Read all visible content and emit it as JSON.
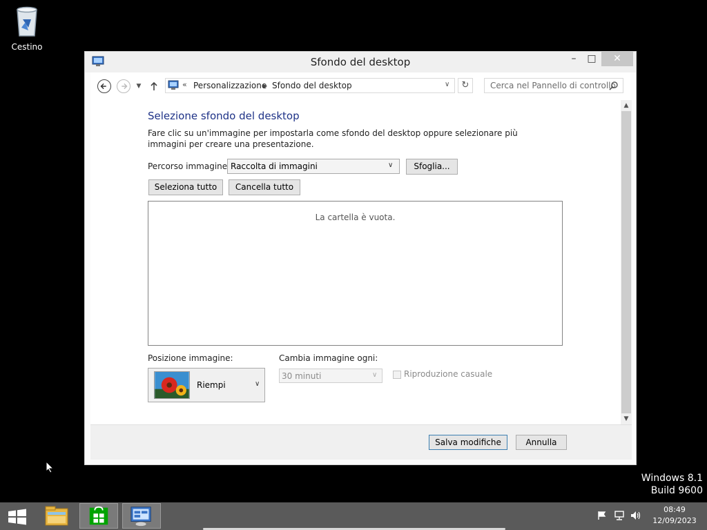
{
  "desktop": {
    "recycle_bin_label": "Cestino",
    "watermark_line1": "Windows 8.1",
    "watermark_line2": "Build 9600"
  },
  "window": {
    "title": "Sfondo del desktop",
    "controls": {
      "minimize": "–",
      "maximize": "□",
      "close": "✕"
    }
  },
  "nav": {
    "breadcrumb_prefix": "«",
    "breadcrumbs": [
      "Personalizzazione",
      "Sfondo del desktop"
    ],
    "search_placeholder": "Cerca nel Pannello di controllo"
  },
  "content": {
    "heading": "Selezione sfondo del desktop",
    "description": "Fare clic su un'immagine per impostarla come sfondo del desktop oppure selezionare più immagini per creare una presentazione.",
    "path_label": "Percorso immagine:",
    "path_value": "Raccolta di immagini",
    "browse_label": "Sfoglia...",
    "select_all_label": "Seleziona tutto",
    "clear_all_label": "Cancella tutto",
    "empty_folder": "La cartella è vuota.",
    "position_label": "Posizione immagine:",
    "position_value": "Riempi",
    "interval_label": "Cambia immagine ogni:",
    "interval_value": "30 minuti",
    "shuffle_label": "Riproduzione casuale",
    "shuffle_checked": false
  },
  "footer": {
    "save_label": "Salva modifiche",
    "cancel_label": "Annulla"
  },
  "taskbar": {
    "time": "08:49",
    "date": "12/09/2023"
  },
  "colors": {
    "heading": "#1e3287",
    "taskbar": "#5a5a5a",
    "store_green": "#00a300"
  }
}
